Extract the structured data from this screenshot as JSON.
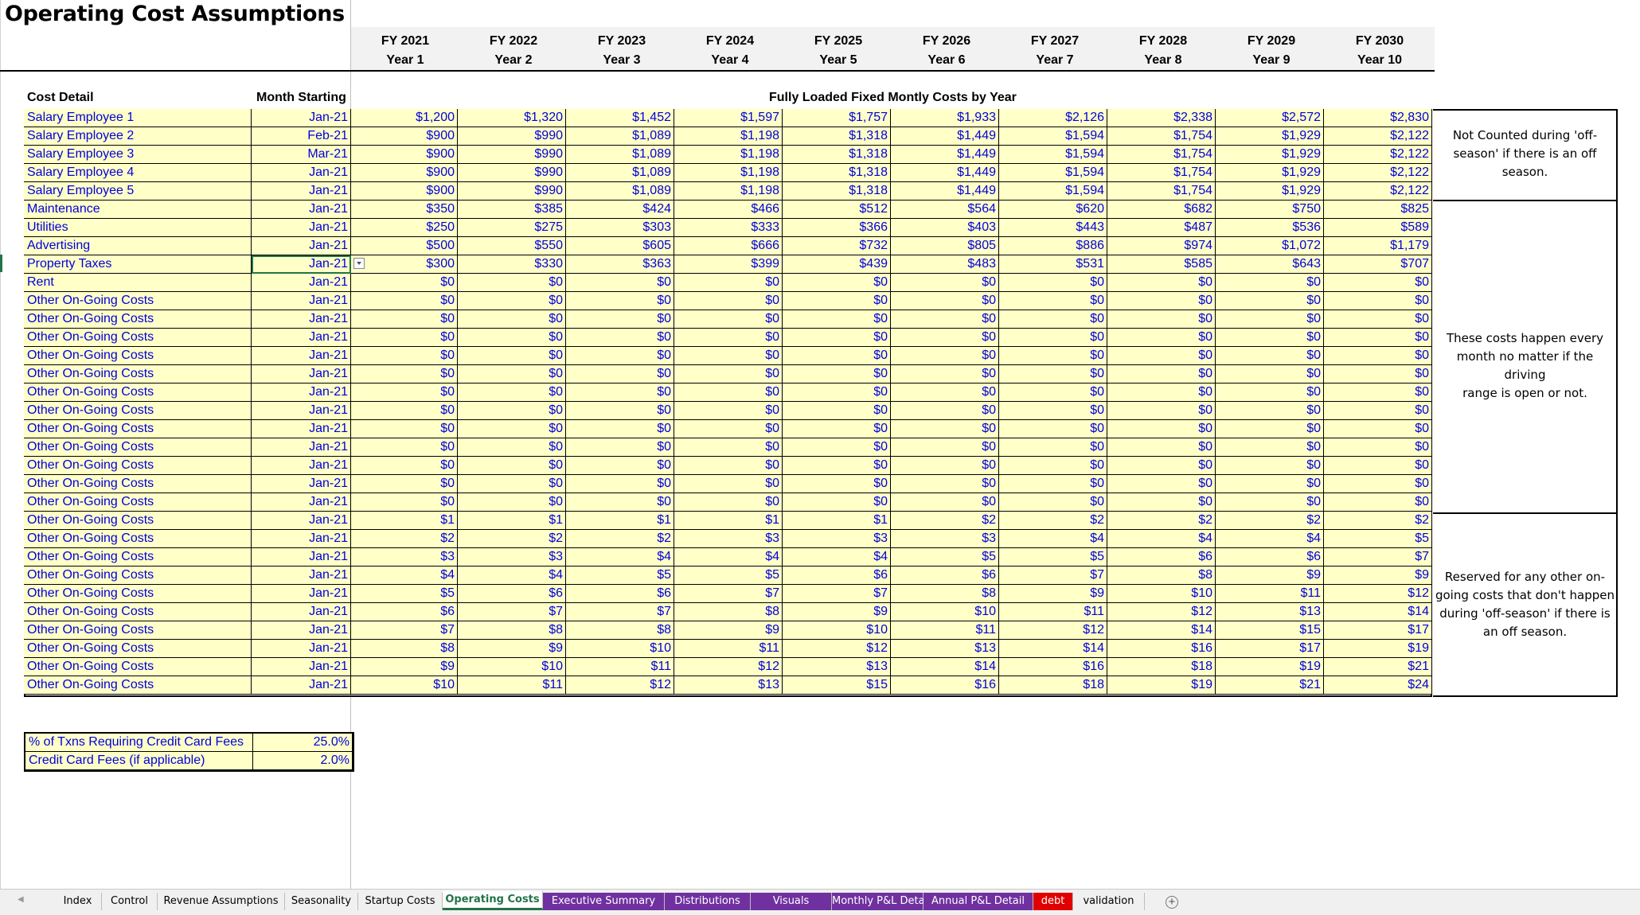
{
  "title": "Operating Cost Assumptions",
  "years": [
    {
      "fy": "FY 2021",
      "yr": "Year 1"
    },
    {
      "fy": "FY 2022",
      "yr": "Year 2"
    },
    {
      "fy": "FY 2023",
      "yr": "Year 3"
    },
    {
      "fy": "FY 2024",
      "yr": "Year 4"
    },
    {
      "fy": "FY 2025",
      "yr": "Year 5"
    },
    {
      "fy": "FY 2026",
      "yr": "Year 6"
    },
    {
      "fy": "FY 2027",
      "yr": "Year 7"
    },
    {
      "fy": "FY 2028",
      "yr": "Year 8"
    },
    {
      "fy": "FY 2029",
      "yr": "Year 9"
    },
    {
      "fy": "FY 2030",
      "yr": "Year 10"
    }
  ],
  "labels": {
    "cost_detail": "Cost Detail",
    "month_starting": "Month Starting",
    "fully_loaded": "Fully Loaded Fixed Montly Costs by Year"
  },
  "rows": [
    {
      "name": "Salary Employee 1",
      "month": "Jan-21",
      "values": [
        "$1,200",
        "$1,320",
        "$1,452",
        "$1,597",
        "$1,757",
        "$1,933",
        "$2,126",
        "$2,338",
        "$2,572",
        "$2,830"
      ]
    },
    {
      "name": "Salary Employee 2",
      "month": "Feb-21",
      "values": [
        "$900",
        "$990",
        "$1,089",
        "$1,198",
        "$1,318",
        "$1,449",
        "$1,594",
        "$1,754",
        "$1,929",
        "$2,122"
      ]
    },
    {
      "name": "Salary Employee 3",
      "month": "Mar-21",
      "values": [
        "$900",
        "$990",
        "$1,089",
        "$1,198",
        "$1,318",
        "$1,449",
        "$1,594",
        "$1,754",
        "$1,929",
        "$2,122"
      ]
    },
    {
      "name": "Salary Employee 4",
      "month": "Jan-21",
      "values": [
        "$900",
        "$990",
        "$1,089",
        "$1,198",
        "$1,318",
        "$1,449",
        "$1,594",
        "$1,754",
        "$1,929",
        "$2,122"
      ]
    },
    {
      "name": "Salary Employee 5",
      "month": "Jan-21",
      "values": [
        "$900",
        "$990",
        "$1,089",
        "$1,198",
        "$1,318",
        "$1,449",
        "$1,594",
        "$1,754",
        "$1,929",
        "$2,122"
      ]
    },
    {
      "name": "Maintenance",
      "month": "Jan-21",
      "values": [
        "$350",
        "$385",
        "$424",
        "$466",
        "$512",
        "$564",
        "$620",
        "$682",
        "$750",
        "$825"
      ]
    },
    {
      "name": "Utilities",
      "month": "Jan-21",
      "values": [
        "$250",
        "$275",
        "$303",
        "$333",
        "$366",
        "$403",
        "$443",
        "$487",
        "$536",
        "$589"
      ]
    },
    {
      "name": "Advertising",
      "month": "Jan-21",
      "values": [
        "$500",
        "$550",
        "$605",
        "$666",
        "$732",
        "$805",
        "$886",
        "$974",
        "$1,072",
        "$1,179"
      ]
    },
    {
      "name": "Property Taxes",
      "month": "Jan-21",
      "values": [
        "$300",
        "$330",
        "$363",
        "$399",
        "$439",
        "$483",
        "$531",
        "$585",
        "$643",
        "$707"
      ]
    },
    {
      "name": "Rent",
      "month": "Jan-21",
      "values": [
        "$0",
        "$0",
        "$0",
        "$0",
        "$0",
        "$0",
        "$0",
        "$0",
        "$0",
        "$0"
      ]
    },
    {
      "name": "Other On-Going Costs",
      "month": "Jan-21",
      "values": [
        "$0",
        "$0",
        "$0",
        "$0",
        "$0",
        "$0",
        "$0",
        "$0",
        "$0",
        "$0"
      ]
    },
    {
      "name": "Other On-Going Costs",
      "month": "Jan-21",
      "values": [
        "$0",
        "$0",
        "$0",
        "$0",
        "$0",
        "$0",
        "$0",
        "$0",
        "$0",
        "$0"
      ]
    },
    {
      "name": "Other On-Going Costs",
      "month": "Jan-21",
      "values": [
        "$0",
        "$0",
        "$0",
        "$0",
        "$0",
        "$0",
        "$0",
        "$0",
        "$0",
        "$0"
      ]
    },
    {
      "name": "Other On-Going Costs",
      "month": "Jan-21",
      "values": [
        "$0",
        "$0",
        "$0",
        "$0",
        "$0",
        "$0",
        "$0",
        "$0",
        "$0",
        "$0"
      ]
    },
    {
      "name": "Other On-Going Costs",
      "month": "Jan-21",
      "values": [
        "$0",
        "$0",
        "$0",
        "$0",
        "$0",
        "$0",
        "$0",
        "$0",
        "$0",
        "$0"
      ]
    },
    {
      "name": "Other On-Going Costs",
      "month": "Jan-21",
      "values": [
        "$0",
        "$0",
        "$0",
        "$0",
        "$0",
        "$0",
        "$0",
        "$0",
        "$0",
        "$0"
      ]
    },
    {
      "name": "Other On-Going Costs",
      "month": "Jan-21",
      "values": [
        "$0",
        "$0",
        "$0",
        "$0",
        "$0",
        "$0",
        "$0",
        "$0",
        "$0",
        "$0"
      ]
    },
    {
      "name": "Other On-Going Costs",
      "month": "Jan-21",
      "values": [
        "$0",
        "$0",
        "$0",
        "$0",
        "$0",
        "$0",
        "$0",
        "$0",
        "$0",
        "$0"
      ]
    },
    {
      "name": "Other On-Going Costs",
      "month": "Jan-21",
      "values": [
        "$0",
        "$0",
        "$0",
        "$0",
        "$0",
        "$0",
        "$0",
        "$0",
        "$0",
        "$0"
      ]
    },
    {
      "name": "Other On-Going Costs",
      "month": "Jan-21",
      "values": [
        "$0",
        "$0",
        "$0",
        "$0",
        "$0",
        "$0",
        "$0",
        "$0",
        "$0",
        "$0"
      ]
    },
    {
      "name": "Other On-Going Costs",
      "month": "Jan-21",
      "values": [
        "$0",
        "$0",
        "$0",
        "$0",
        "$0",
        "$0",
        "$0",
        "$0",
        "$0",
        "$0"
      ]
    },
    {
      "name": "Other On-Going Costs",
      "month": "Jan-21",
      "values": [
        "$0",
        "$0",
        "$0",
        "$0",
        "$0",
        "$0",
        "$0",
        "$0",
        "$0",
        "$0"
      ]
    },
    {
      "name": "Other On-Going Costs",
      "month": "Jan-21",
      "values": [
        "$1",
        "$1",
        "$1",
        "$1",
        "$1",
        "$2",
        "$2",
        "$2",
        "$2",
        "$2"
      ]
    },
    {
      "name": "Other On-Going Costs",
      "month": "Jan-21",
      "values": [
        "$2",
        "$2",
        "$2",
        "$3",
        "$3",
        "$3",
        "$4",
        "$4",
        "$4",
        "$5"
      ]
    },
    {
      "name": "Other On-Going Costs",
      "month": "Jan-21",
      "values": [
        "$3",
        "$3",
        "$4",
        "$4",
        "$4",
        "$5",
        "$5",
        "$6",
        "$6",
        "$7"
      ]
    },
    {
      "name": "Other On-Going Costs",
      "month": "Jan-21",
      "values": [
        "$4",
        "$4",
        "$5",
        "$5",
        "$6",
        "$6",
        "$7",
        "$8",
        "$9",
        "$9"
      ]
    },
    {
      "name": "Other On-Going Costs",
      "month": "Jan-21",
      "values": [
        "$5",
        "$6",
        "$6",
        "$7",
        "$7",
        "$8",
        "$9",
        "$10",
        "$11",
        "$12"
      ]
    },
    {
      "name": "Other On-Going Costs",
      "month": "Jan-21",
      "values": [
        "$6",
        "$7",
        "$7",
        "$8",
        "$9",
        "$10",
        "$11",
        "$12",
        "$13",
        "$14"
      ]
    },
    {
      "name": "Other On-Going Costs",
      "month": "Jan-21",
      "values": [
        "$7",
        "$8",
        "$8",
        "$9",
        "$10",
        "$11",
        "$12",
        "$14",
        "$15",
        "$17"
      ]
    },
    {
      "name": "Other On-Going Costs",
      "month": "Jan-21",
      "values": [
        "$8",
        "$9",
        "$10",
        "$11",
        "$12",
        "$13",
        "$14",
        "$16",
        "$17",
        "$19"
      ]
    },
    {
      "name": "Other On-Going Costs",
      "month": "Jan-21",
      "values": [
        "$9",
        "$10",
        "$11",
        "$12",
        "$13",
        "$14",
        "$16",
        "$18",
        "$19",
        "$21"
      ]
    },
    {
      "name": "Other On-Going Costs",
      "month": "Jan-21",
      "values": [
        "$10",
        "$11",
        "$12",
        "$13",
        "$15",
        "$16",
        "$18",
        "$19",
        "$21",
        "$24"
      ]
    }
  ],
  "notes": {
    "off_season": [
      "Not Counted during 'off-",
      "season' if there is an off",
      "season."
    ],
    "every_month": [
      "These costs happen every",
      "month no matter if the driving",
      "range is open or not."
    ],
    "reserved": [
      "Reserved for any other on-",
      "going costs that don't happen",
      "during 'off-season' if there is",
      "an off season."
    ]
  },
  "credit_card": [
    {
      "label": "% of Txns Requiring Credit Card Fees",
      "value": "25.0%"
    },
    {
      "label": "Credit Card Fees (if applicable)",
      "value": "2.0%"
    }
  ],
  "tabs": [
    {
      "label": "Index",
      "style": "plain"
    },
    {
      "label": "Control",
      "style": "plain"
    },
    {
      "label": "Revenue Assumptions",
      "style": "plain"
    },
    {
      "label": "Seasonality",
      "style": "plain"
    },
    {
      "label": "Startup Costs",
      "style": "plain"
    },
    {
      "label": "Operating Costs",
      "style": "active"
    },
    {
      "label": "Executive Summary",
      "style": "purple"
    },
    {
      "label": "Distributions",
      "style": "purple"
    },
    {
      "label": "Visuals",
      "style": "purple"
    },
    {
      "label": "Monthly P&L Detail",
      "style": "purple"
    },
    {
      "label": "Annual P&L Detail",
      "style": "purple"
    },
    {
      "label": "debt",
      "style": "red"
    },
    {
      "label": "validation",
      "style": "plain"
    }
  ],
  "icons": {
    "add_sheet": "plus-circle-icon",
    "scroll_left": "triangle-left-icon",
    "dropdown": "dropdown-arrow-icon"
  },
  "colors": {
    "cell_fill": "#ffffc8",
    "input_text": "#0000dd",
    "active_tab": "#217346",
    "purple_tab": "#7030a0",
    "red_tab": "#e00000"
  }
}
